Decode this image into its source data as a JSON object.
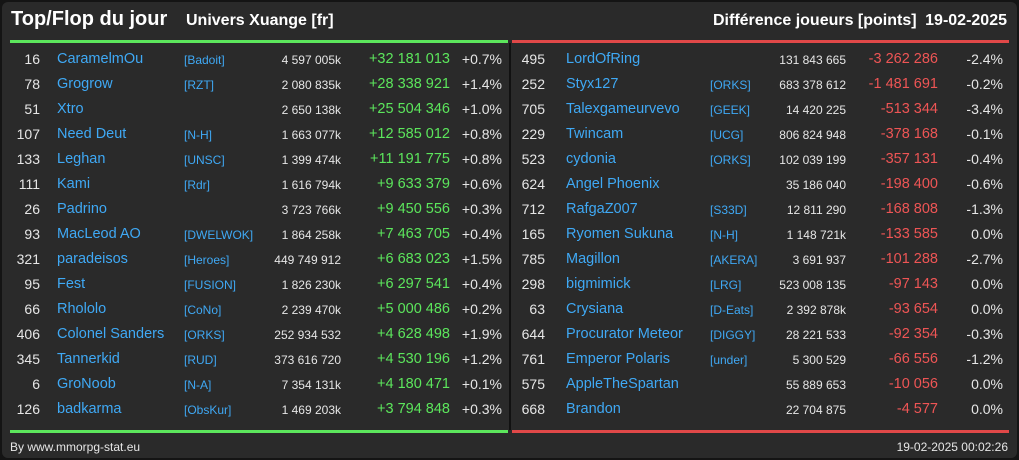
{
  "header": {
    "title": "Top/Flop du jour",
    "universe": "Univers Xuange [fr]",
    "diff_label": "Différence joueurs [points]",
    "date": "19-02-2025"
  },
  "colors": {
    "background": "#2a2a2a",
    "top_accent": "#5ce65c",
    "flop_accent": "#e04848",
    "name_link": "#3fa9f5"
  },
  "top": [
    {
      "rank": "16",
      "name": "CaramelmOu",
      "guild": "[Badoit]",
      "points": "4 597 005k",
      "diff": "+32 181 013",
      "pct": "+0.7%"
    },
    {
      "rank": "78",
      "name": "Grogrow",
      "guild": "[RZT]",
      "points": "2 080 835k",
      "diff": "+28 338 921",
      "pct": "+1.4%"
    },
    {
      "rank": "51",
      "name": "Xtro",
      "guild": "",
      "points": "2 650 138k",
      "diff": "+25 504 346",
      "pct": "+1.0%"
    },
    {
      "rank": "107",
      "name": "Need Deut",
      "guild": "[N-H]",
      "points": "1 663 077k",
      "diff": "+12 585 012",
      "pct": "+0.8%"
    },
    {
      "rank": "133",
      "name": "Leghan",
      "guild": "[UNSC]",
      "points": "1 399 474k",
      "diff": "+11 191 775",
      "pct": "+0.8%"
    },
    {
      "rank": "111",
      "name": "Kami",
      "guild": "[Rdr]",
      "points": "1 616 794k",
      "diff": "+9 633 379",
      "pct": "+0.6%"
    },
    {
      "rank": "26",
      "name": "Padrino",
      "guild": "",
      "points": "3 723 766k",
      "diff": "+9 450 556",
      "pct": "+0.3%"
    },
    {
      "rank": "93",
      "name": "MacLeod AO",
      "guild": "[DWELWOK]",
      "points": "1 864 258k",
      "diff": "+7 463 705",
      "pct": "+0.4%"
    },
    {
      "rank": "321",
      "name": "paradeisos",
      "guild": "[Heroes]",
      "points": "449 749 912",
      "diff": "+6 683 023",
      "pct": "+1.5%"
    },
    {
      "rank": "95",
      "name": "Fest",
      "guild": "[FUSION]",
      "points": "1 826 230k",
      "diff": "+6 297 541",
      "pct": "+0.4%"
    },
    {
      "rank": "66",
      "name": "Rhololo",
      "guild": "[CoNo]",
      "points": "2 239 470k",
      "diff": "+5 000 486",
      "pct": "+0.2%"
    },
    {
      "rank": "406",
      "name": "Colonel Sanders",
      "guild": "[ORKS]",
      "points": "252 934 532",
      "diff": "+4 628 498",
      "pct": "+1.9%"
    },
    {
      "rank": "345",
      "name": "Tannerkid",
      "guild": "[RUD]",
      "points": "373 616 720",
      "diff": "+4 530 196",
      "pct": "+1.2%"
    },
    {
      "rank": "6",
      "name": "GroNoob",
      "guild": "[N-A]",
      "points": "7 354 131k",
      "diff": "+4 180 471",
      "pct": "+0.1%"
    },
    {
      "rank": "126",
      "name": "badkarma",
      "guild": "[ObsKur]",
      "points": "1 469 203k",
      "diff": "+3 794 848",
      "pct": "+0.3%"
    }
  ],
  "flop": [
    {
      "rank": "495",
      "name": "LordOfRing",
      "guild": "",
      "points": "131 843 665",
      "diff": "-3 262 286",
      "pct": "-2.4%"
    },
    {
      "rank": "252",
      "name": "Styx127",
      "guild": "[ORKS]",
      "points": "683 378 612",
      "diff": "-1 481 691",
      "pct": "-0.2%"
    },
    {
      "rank": "705",
      "name": "Talexgameurvevo",
      "guild": "[GEEK]",
      "points": "14 420 225",
      "diff": "-513 344",
      "pct": "-3.4%"
    },
    {
      "rank": "229",
      "name": "Twincam",
      "guild": "[UCG]",
      "points": "806 824 948",
      "diff": "-378 168",
      "pct": "-0.1%"
    },
    {
      "rank": "523",
      "name": "cydonia",
      "guild": "[ORKS]",
      "points": "102 039 199",
      "diff": "-357 131",
      "pct": "-0.4%"
    },
    {
      "rank": "624",
      "name": "Angel Phoenix",
      "guild": "",
      "points": "35 186 040",
      "diff": "-198 400",
      "pct": "-0.6%"
    },
    {
      "rank": "712",
      "name": "RafgaZ007",
      "guild": "[S33D]",
      "points": "12 811 290",
      "diff": "-168 808",
      "pct": "-1.3%"
    },
    {
      "rank": "165",
      "name": "Ryomen Sukuna",
      "guild": "[N-H]",
      "points": "1 148 721k",
      "diff": "-133 585",
      "pct": "0.0%"
    },
    {
      "rank": "785",
      "name": "Magillon",
      "guild": "[AKERA]",
      "points": "3 691 937",
      "diff": "-101 288",
      "pct": "-2.7%"
    },
    {
      "rank": "298",
      "name": "bigmimick",
      "guild": "[LRG]",
      "points": "523 008 135",
      "diff": "-97 143",
      "pct": "0.0%"
    },
    {
      "rank": "63",
      "name": "Crysiana",
      "guild": "[D-Eats]",
      "points": "2 392 878k",
      "diff": "-93 654",
      "pct": "0.0%"
    },
    {
      "rank": "644",
      "name": "Procurator Meteor",
      "guild": "[DIGGY]",
      "points": "28 221 533",
      "diff": "-92 354",
      "pct": "-0.3%"
    },
    {
      "rank": "761",
      "name": "Emperor Polaris",
      "guild": "[under]",
      "points": "5 300 529",
      "diff": "-66 556",
      "pct": "-1.2%"
    },
    {
      "rank": "575",
      "name": "AppleTheSpartan",
      "guild": "",
      "points": "55 889 653",
      "diff": "-10 056",
      "pct": "0.0%"
    },
    {
      "rank": "668",
      "name": "Brandon",
      "guild": "",
      "points": "22 704 875",
      "diff": "-4 577",
      "pct": "0.0%"
    }
  ],
  "footer": {
    "source": "By www.mmorpg-stat.eu",
    "timestamp": "19-02-2025 00:02:26"
  }
}
